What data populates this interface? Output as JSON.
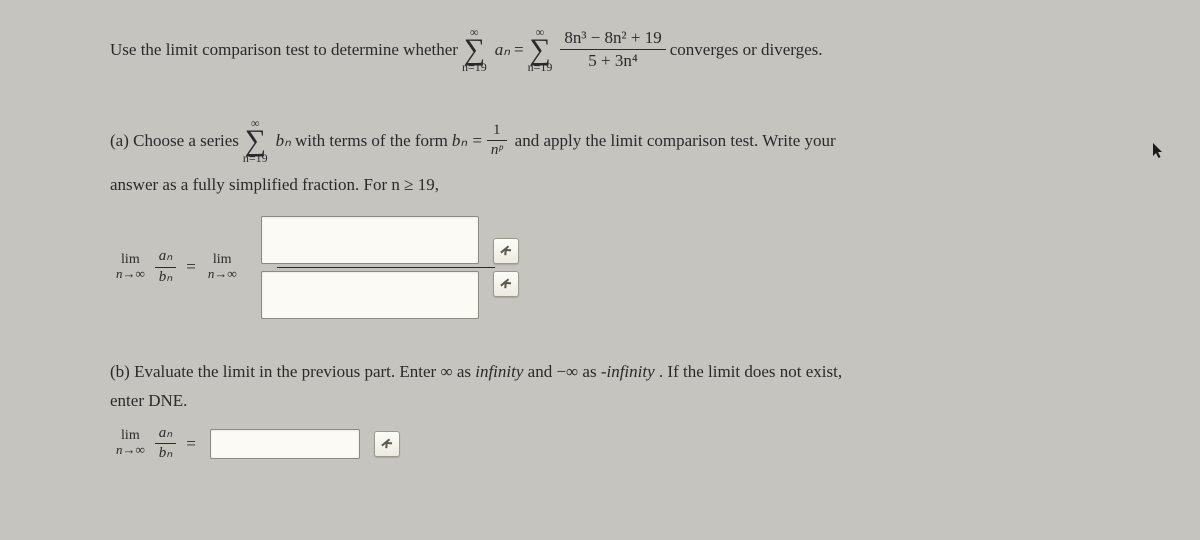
{
  "intro": {
    "text1": "Use the limit comparison test to determine whether ",
    "sum_upper": "∞",
    "sum_lower": "n=19",
    "an": "aₙ",
    "eq": " = ",
    "frac_num": "8n³ − 8n² + 19",
    "frac_den": "5 + 3n⁴",
    "text2": " converges or diverges."
  },
  "part_a": {
    "label": "(a) Choose a series ",
    "sum_upper": "∞",
    "sum_lower": "n=19",
    "bn": "bₙ",
    "text1": " with terms of the form ",
    "bneq": "bₙ = ",
    "frac_num": "1",
    "frac_den": "nᵖ",
    "text2": " and apply the limit comparison test. Write your",
    "text3": "answer as a fully simplified fraction. For n ≥ 19,"
  },
  "equation_a": {
    "lim": "lim",
    "limsub": "n→∞",
    "frac_top": "aₙ",
    "frac_bot": "bₙ",
    "eq": " = ",
    "lim2": "lim",
    "limsub2": "n→∞"
  },
  "part_b": {
    "text1": "(b) Evaluate the limit in the previous part. Enter ∞ as ",
    "infinity": "infinity",
    "text2": " and −∞ as ",
    "neg_infinity": "-infinity",
    "text3": ". If the limit does not exist,",
    "text4": "enter DNE."
  },
  "equation_b": {
    "lim": "lim",
    "limsub": "n→∞",
    "frac_top": "aₙ",
    "frac_bot": "bₙ",
    "eq": " = "
  }
}
